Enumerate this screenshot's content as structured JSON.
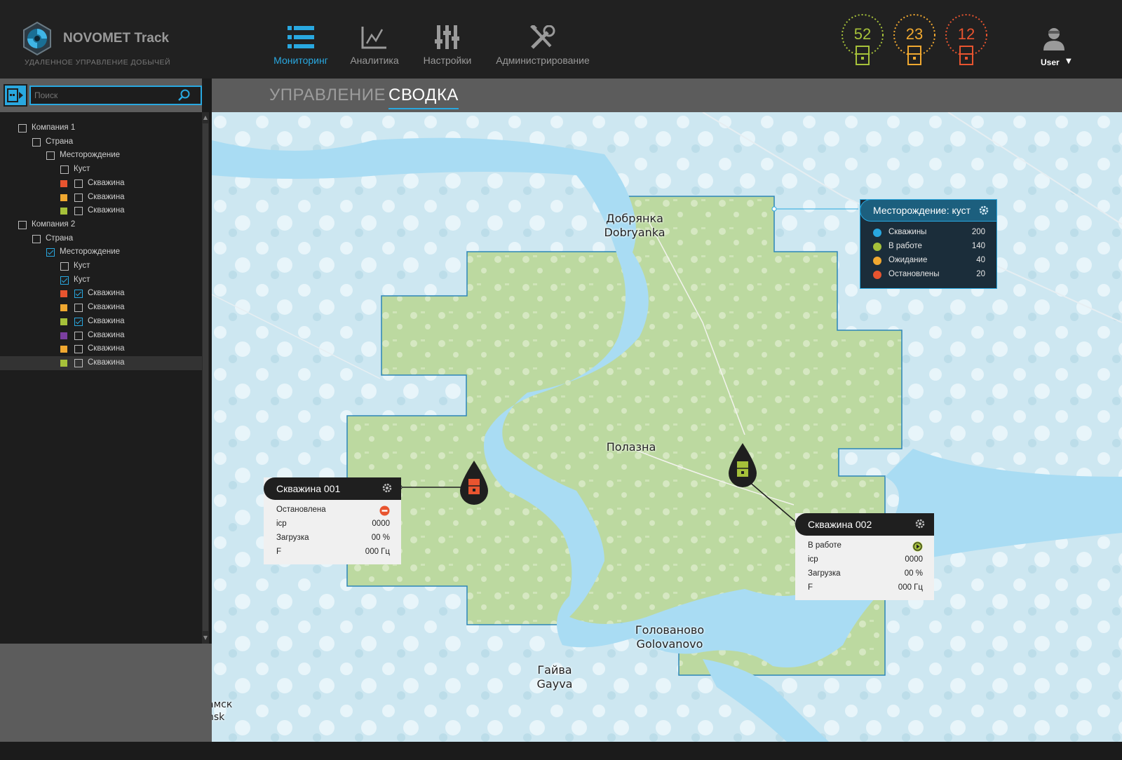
{
  "app": {
    "brand": "NOVOMET Track",
    "tagline": "УДАЛЕННОЕ УПРАВЛЕНИЕ ДОБЫЧЕЙ"
  },
  "nav": [
    {
      "label": "Мониторинг",
      "icon": "list-icon",
      "active": true
    },
    {
      "label": "Аналитика",
      "icon": "chart-icon",
      "active": false
    },
    {
      "label": "Настройки",
      "icon": "sliders-icon",
      "active": false
    },
    {
      "label": "Администрирование",
      "icon": "tools-icon",
      "active": false
    }
  ],
  "counters": [
    {
      "value": "52",
      "color": "#a6c13a",
      "status": "working"
    },
    {
      "value": "23",
      "color": "#f0a830",
      "status": "waiting"
    },
    {
      "value": "12",
      "color": "#e8542f",
      "status": "stopped"
    }
  ],
  "user": {
    "name": "User"
  },
  "search": {
    "placeholder": "Поиск"
  },
  "tree": [
    {
      "label": "Компания 1",
      "level": 0,
      "checked": false,
      "swatch": null
    },
    {
      "label": "Страна",
      "level": 1,
      "checked": false,
      "swatch": null
    },
    {
      "label": "Месторождение",
      "level": 2,
      "checked": false,
      "swatch": null
    },
    {
      "label": "Куст",
      "level": 3,
      "checked": false,
      "swatch": null
    },
    {
      "label": "Скважина",
      "level": 4,
      "checked": false,
      "swatch": "#e8542f"
    },
    {
      "label": "Скважина",
      "level": 4,
      "checked": false,
      "swatch": "#f0a830"
    },
    {
      "label": "Скважина",
      "level": 4,
      "checked": false,
      "swatch": "#a6c13a"
    },
    {
      "label": "Компания 2",
      "level": 0,
      "checked": false,
      "swatch": null
    },
    {
      "label": "Страна",
      "level": 1,
      "checked": false,
      "swatch": null
    },
    {
      "label": "Месторождение",
      "level": 2,
      "checked": true,
      "swatch": null
    },
    {
      "label": "Куст",
      "level": 3,
      "checked": false,
      "swatch": null
    },
    {
      "label": "Куст",
      "level": 3,
      "checked": true,
      "swatch": null
    },
    {
      "label": "Скважина",
      "level": 4,
      "checked": true,
      "swatch": "#e8542f"
    },
    {
      "label": "Скважина",
      "level": 4,
      "checked": false,
      "swatch": "#f0a830"
    },
    {
      "label": "Скважина",
      "level": 4,
      "checked": true,
      "swatch": "#a6c13a"
    },
    {
      "label": "Скважина",
      "level": 4,
      "checked": false,
      "swatch": "#7b3fa0"
    },
    {
      "label": "Скважина",
      "level": 4,
      "checked": false,
      "swatch": "#f0a830"
    },
    {
      "label": "Скважина",
      "level": 4,
      "checked": false,
      "swatch": "#a6c13a",
      "highlighted": true
    }
  ],
  "tabs": [
    {
      "label": "УПРАВЛЕНИЕ",
      "active": false
    },
    {
      "label": "СВОДКА",
      "active": true
    }
  ],
  "places": {
    "dobryanka": "Добрянка\nDobryanka",
    "polazna": "Полазна",
    "golovanovo": "Голованово\nGolovanovo",
    "gayva": "Гайва\nGayva",
    "perm": "амск\nnsk"
  },
  "field_card": {
    "title": "Месторождение: куст",
    "rows": [
      {
        "label": "Скважины",
        "value": "200",
        "icon": "check-icon",
        "color": "#29a8e0"
      },
      {
        "label": "В работе",
        "value": "140",
        "icon": "play-icon",
        "color": "#a6c13a"
      },
      {
        "label": "Ожидание",
        "value": "40",
        "icon": "pause-icon",
        "color": "#f0a830"
      },
      {
        "label": "Остановлены",
        "value": "20",
        "icon": "stop-icon",
        "color": "#e8542f"
      }
    ]
  },
  "well1": {
    "title": "Скважина 001",
    "status": "Остановлена",
    "status_color": "#e8542f",
    "rows": [
      {
        "label": "icp",
        "value": "0000"
      },
      {
        "label": "Загрузка",
        "value": "00 %"
      },
      {
        "label": "F",
        "value": "000 Гц"
      }
    ]
  },
  "well2": {
    "title": "Скважина 002",
    "status": "В работе",
    "status_color": "#a6c13a",
    "rows": [
      {
        "label": "icp",
        "value": "0000"
      },
      {
        "label": "Загрузка",
        "value": "00 %"
      },
      {
        "label": "F",
        "value": "000 Гц"
      }
    ]
  },
  "colors": {
    "accent": "#29a8e0",
    "forest": "#b9d79a",
    "water": "#a9dcf3"
  }
}
